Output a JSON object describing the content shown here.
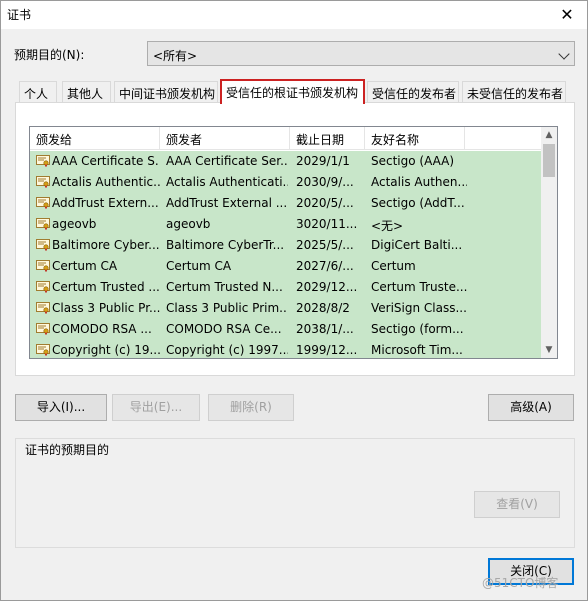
{
  "window": {
    "title": "证书",
    "close_symbol": "✕"
  },
  "purpose": {
    "label": "预期目的(N):",
    "value": "<所有>"
  },
  "tabs": [
    {
      "label": "个人"
    },
    {
      "label": "其他人"
    },
    {
      "label": "中间证书颁发机构"
    },
    {
      "label": "受信任的根证书颁发机构",
      "active": true
    },
    {
      "label": "受信任的发布者"
    },
    {
      "label": "未受信任的发布者"
    }
  ],
  "list": {
    "columns": [
      "颁发给",
      "颁发者",
      "截止日期",
      "友好名称"
    ],
    "rows": [
      [
        "AAA Certificate S...",
        "AAA Certificate Ser...",
        "2029/1/1",
        "Sectigo (AAA)"
      ],
      [
        "Actalis Authentic...",
        "Actalis Authenticati...",
        "2030/9/...",
        "Actalis Authen..."
      ],
      [
        "AddTrust Extern...",
        "AddTrust External ...",
        "2020/5/...",
        "Sectigo (AddT..."
      ],
      [
        "ageovb",
        "ageovb",
        "3020/11...",
        "<无>"
      ],
      [
        "Baltimore Cyber...",
        "Baltimore CyberTr...",
        "2025/5/...",
        "DigiCert Balti..."
      ],
      [
        "Certum CA",
        "Certum CA",
        "2027/6/...",
        "Certum"
      ],
      [
        "Certum Trusted ...",
        "Certum Trusted N...",
        "2029/12...",
        "Certum Truste..."
      ],
      [
        "Class 3 Public Pr...",
        "Class 3 Public Prim...",
        "2028/8/2",
        "VeriSign Class..."
      ],
      [
        "COMODO RSA ...",
        "COMODO RSA Ce...",
        "2038/1/...",
        "Sectigo (form..."
      ],
      [
        "Copyright (c) 19...",
        "Copyright (c) 1997...",
        "1999/12...",
        "Microsoft Tim..."
      ]
    ],
    "row_color": "#c8e6c9"
  },
  "buttons": {
    "import": "导入(I)...",
    "export": "导出(E)...",
    "remove": "删除(R)",
    "advanced": "高级(A)",
    "view": "查看(V)",
    "close": "关闭(C)"
  },
  "group": {
    "label": "证书的预期目的"
  },
  "watermark": "@51CTO博客",
  "colors": {
    "active_tab_border": "#cc2222",
    "default_button_border": "#0078d7"
  }
}
